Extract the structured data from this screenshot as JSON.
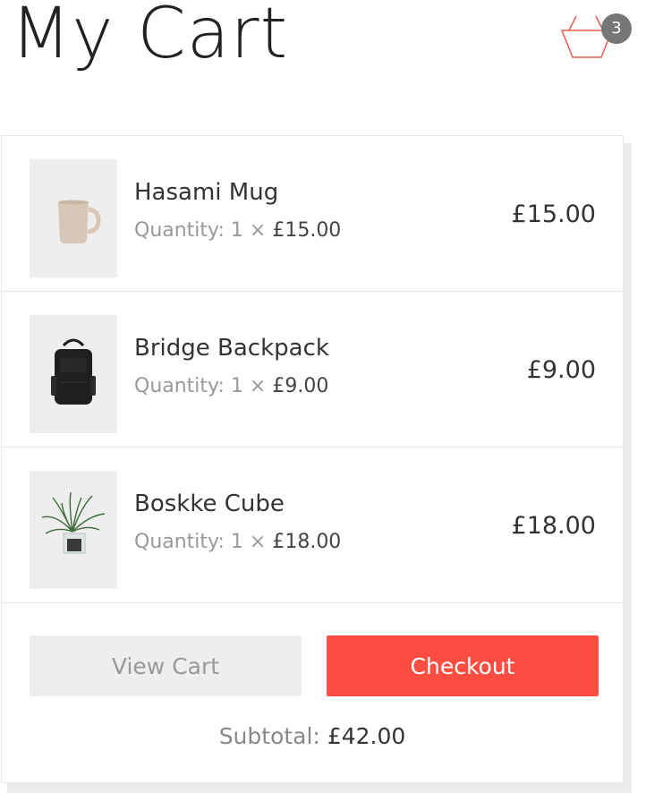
{
  "header": {
    "title": "My Cart",
    "cart_count": "3",
    "cart_icon": "basket-icon",
    "cart_icon_color": "#e85a4f"
  },
  "cart": {
    "items": [
      {
        "name": "Hasami Mug",
        "quantity_label": "Quantity:",
        "quantity": "1",
        "times": "×",
        "unit_price": "£15.00",
        "total": "£15.00",
        "image_icon": "mug-image"
      },
      {
        "name": "Bridge Backpack",
        "quantity_label": "Quantity:",
        "quantity": "1",
        "times": "×",
        "unit_price": "£9.00",
        "total": "£9.00",
        "image_icon": "backpack-image"
      },
      {
        "name": "Boskke Cube",
        "quantity_label": "Quantity:",
        "quantity": "1",
        "times": "×",
        "unit_price": "£18.00",
        "total": "£18.00",
        "image_icon": "plant-image"
      }
    ],
    "view_cart_label": "View Cart",
    "checkout_label": "Checkout",
    "subtotal_label": "Subtotal:",
    "subtotal_amount": "£42.00"
  },
  "colors": {
    "accent": "#ff4d41",
    "badge": "#777777",
    "muted_text": "#999999"
  }
}
